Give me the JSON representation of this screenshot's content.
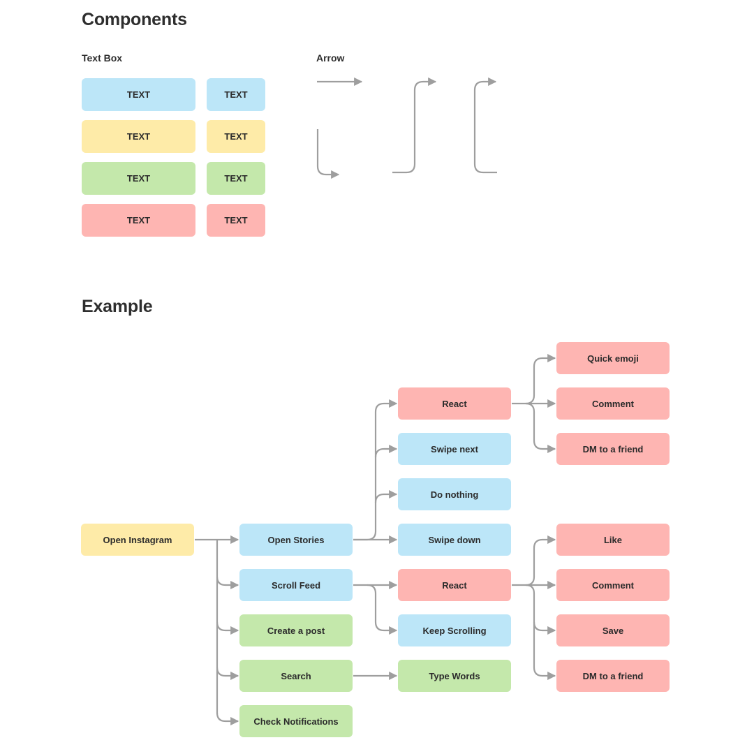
{
  "components": {
    "title": "Components",
    "text_box_label": "Text Box",
    "arrow_label": "Arrow",
    "swatches": [
      {
        "wide": "TEXT",
        "narrow": "TEXT",
        "color": "#bce6f8"
      },
      {
        "wide": "TEXT",
        "narrow": "TEXT",
        "color": "#feeba8"
      },
      {
        "wide": "TEXT",
        "narrow": "TEXT",
        "color": "#c4e8ab"
      },
      {
        "wide": "TEXT",
        "narrow": "TEXT",
        "color": "#feb5b2"
      }
    ],
    "arrow_styles": [
      "straight-right",
      "down-then-right",
      "s-curve-up-right",
      "bracket-up-right"
    ]
  },
  "example": {
    "title": "Example",
    "nodes": {
      "open_instagram": "Open Instagram",
      "open_stories": "Open Stories",
      "scroll_feed": "Scroll Feed",
      "create_post": "Create a post",
      "search": "Search",
      "check_notifications": "Check Notifications",
      "stories_react": "React",
      "swipe_next": "Swipe next",
      "do_nothing": "Do nothing",
      "swipe_down": "Swipe down",
      "feed_react": "React",
      "keep_scrolling": "Keep Scrolling",
      "type_words": "Type Words",
      "quick_emoji": "Quick emoji",
      "stories_comment": "Comment",
      "stories_dm": "DM to a friend",
      "like": "Like",
      "feed_comment": "Comment",
      "save": "Save",
      "feed_dm": "DM to a friend"
    },
    "colors": {
      "blue": "#bce6f8",
      "yellow": "#feeba8",
      "green": "#c4e8ab",
      "red": "#feb5b2",
      "connector": "#9e9e9e"
    }
  }
}
